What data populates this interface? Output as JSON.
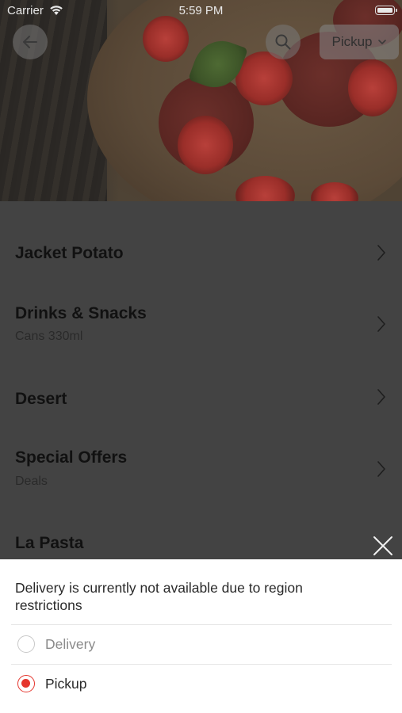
{
  "status_bar": {
    "carrier": "Carrier",
    "time": "5:59 PM"
  },
  "header": {
    "pickup_label": "Pickup"
  },
  "menu": {
    "items": [
      {
        "title": "Jacket Potato",
        "subtitle": ""
      },
      {
        "title": "Drinks & Snacks",
        "subtitle": "Cans 330ml"
      },
      {
        "title": "Desert",
        "subtitle": ""
      },
      {
        "title": "Special Offers",
        "subtitle": "Deals"
      },
      {
        "title": "La Pasta",
        "subtitle": ""
      }
    ]
  },
  "sheet": {
    "message": "Delivery is currently not available due to region restrictions",
    "options": [
      {
        "label": "Delivery",
        "selected": false,
        "enabled": false
      },
      {
        "label": "Pickup",
        "selected": true,
        "enabled": true
      }
    ]
  },
  "colors": {
    "accent": "#e5352d",
    "overlay": "#434343"
  },
  "icons": [
    "back-arrow-icon",
    "search-icon",
    "chevron-down-icon",
    "chevron-right-icon",
    "close-icon",
    "wifi-icon",
    "battery-icon"
  ]
}
